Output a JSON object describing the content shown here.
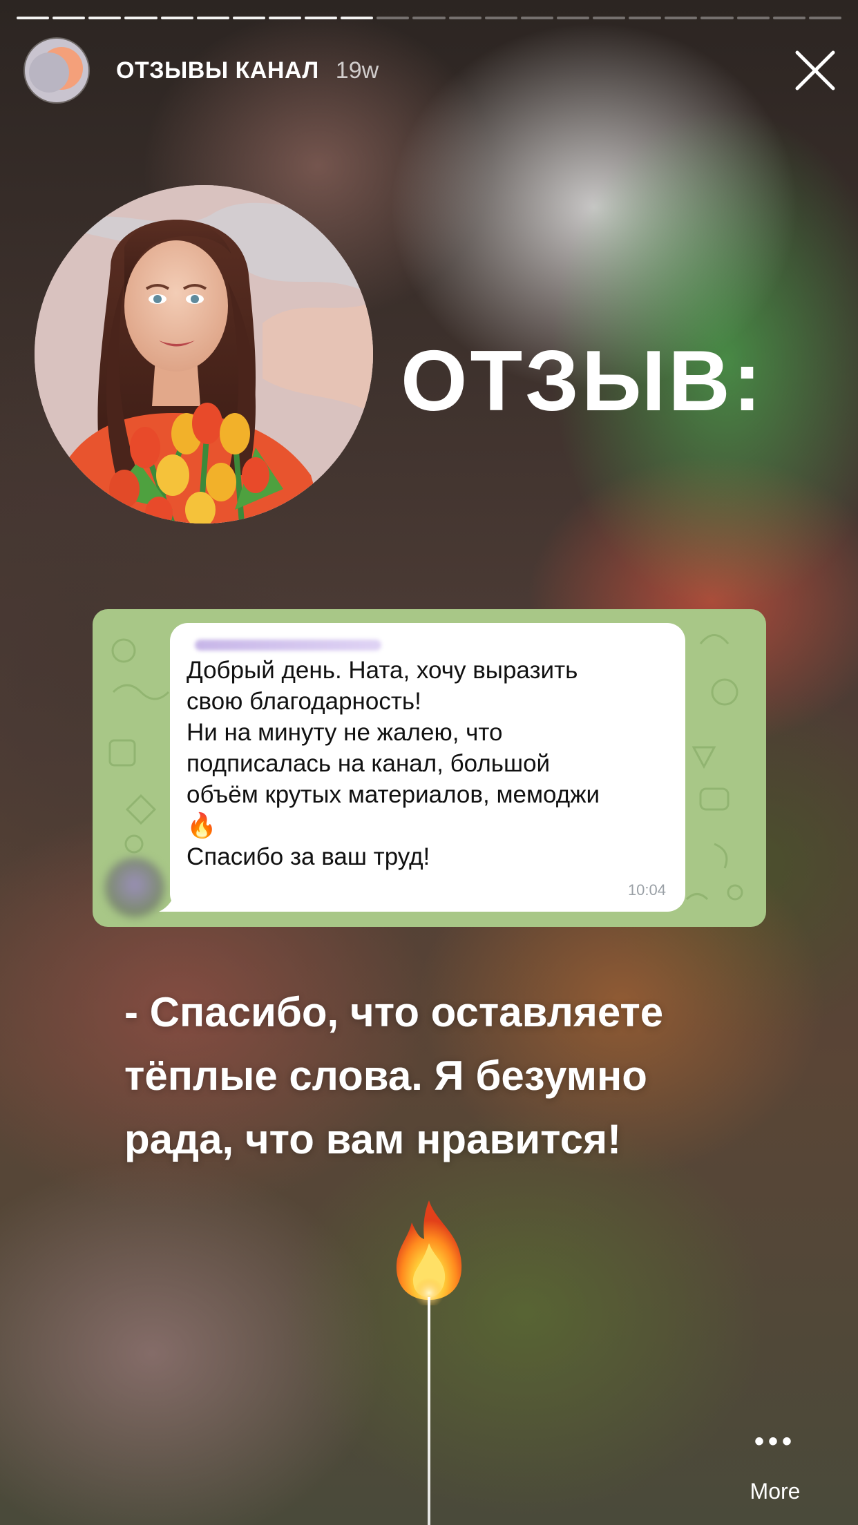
{
  "story": {
    "channel_name": "ОТЗЫВЫ КАНАЛ",
    "time_ago": "19w",
    "progress": {
      "segments_total": 23,
      "segments_done": 10
    }
  },
  "content": {
    "title": "ОТЗЫВ:",
    "review_message": {
      "lines": [
        "Добрый день. Ната, хочу выразить",
        "свою благодарность!",
        "Ни на минуту не жалею, что",
        "подписалась на канал, большой",
        "объём крутых материалов, мемоджи",
        "🔥",
        "Спасибо за ваш труд!"
      ],
      "time": "10:04"
    },
    "caption_lines": [
      "- Спасибо, что оставляете",
      "тёплые слова. Я безумно",
      "рада, что вам нравится!"
    ]
  },
  "footer": {
    "more_label": "More",
    "more_icon": "•••"
  },
  "icons": {
    "close": "close-icon",
    "more": "more-dots-icon",
    "fire": "fire-sticker"
  }
}
